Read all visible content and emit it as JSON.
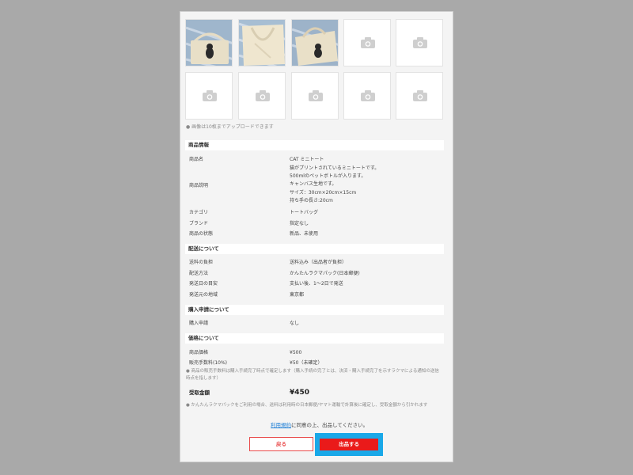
{
  "upload_note": "● 画像は10枚までアップロードできます",
  "photos": [
    "camera-icon"
  ],
  "sections": {
    "product": {
      "title": "商品情報",
      "name_label": "商品名",
      "name_value": "CAT ミニトート",
      "desc_label": "商品説明",
      "desc_lines": [
        "猫がプリントされているミニトートです。",
        "500mlのペットボトルが入ります。",
        "キャンバス生地です。",
        "サイズ：30cm×20cm×15cm",
        "持ち手の長さ:20cm"
      ],
      "category_label": "カテゴリ",
      "category_value": "トートバッグ",
      "brand_label": "ブランド",
      "brand_value": "指定なし",
      "condition_label": "商品の状態",
      "condition_value": "新品、未使用"
    },
    "shipping": {
      "title": "配送について",
      "fee_label": "送料の負担",
      "fee_value": "送料込み（出品者が負担）",
      "method_label": "配送方法",
      "method_value": "かんたんラクマパック(日本郵便)",
      "days_label": "発送日の目安",
      "days_value": "支払い後、1〜2日で発送",
      "origin_label": "発送元の地域",
      "origin_value": "東京都"
    },
    "purchase": {
      "title": "購入申請について",
      "request_label": "購入申請",
      "request_value": "なし"
    },
    "price": {
      "title": "価格について",
      "price_label": "商品価格",
      "price_value": "¥500",
      "fee_label": "販売手数料(10%)",
      "fee_value": "¥50（未確定）",
      "fee_note": "● 商品の販売手数料は購入手続完了時点で確定します（購入手続の完了とは、決済・購入手続完了を示すラクマによる通知の送信時点を指します）",
      "earnings_label": "受取金額",
      "earnings_value": "¥450",
      "shipping_note": "● かんたんラクマパックをご利用の場合、送料は利用時の日本郵便/ヤマト運輸で計算後に確定し、受取金額から引かれます"
    }
  },
  "agree": {
    "link": "利用規約",
    "text": "に同意の上、出品してください。"
  },
  "buttons": {
    "back": "戻る",
    "submit": "出品する"
  }
}
